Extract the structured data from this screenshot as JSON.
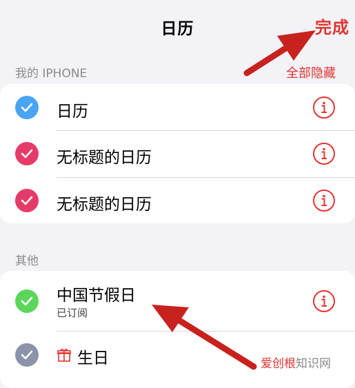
{
  "header": {
    "title": "日历",
    "done_label": "完成"
  },
  "section_iphone": {
    "label": "我的 IPHONE",
    "action_label": "全部隐藏"
  },
  "iphone_calendars": [
    {
      "label": "日历",
      "color": "#4aa4f4"
    },
    {
      "label": "无标题的日历",
      "color": "#e53b68"
    },
    {
      "label": "无标题的日历",
      "color": "#e53b68"
    }
  ],
  "section_other": {
    "label": "其他"
  },
  "other_calendars": [
    {
      "label": "中国节假日",
      "sublabel": "已订阅",
      "color": "#5cd65a"
    },
    {
      "label": "生日",
      "color": "#8a93a8",
      "icon": "gift-icon"
    }
  ],
  "watermark": {
    "part1": "爱创根",
    "part2": "知识网"
  },
  "colors": {
    "accent": "#e0342f",
    "arrow": "#c8221e"
  }
}
